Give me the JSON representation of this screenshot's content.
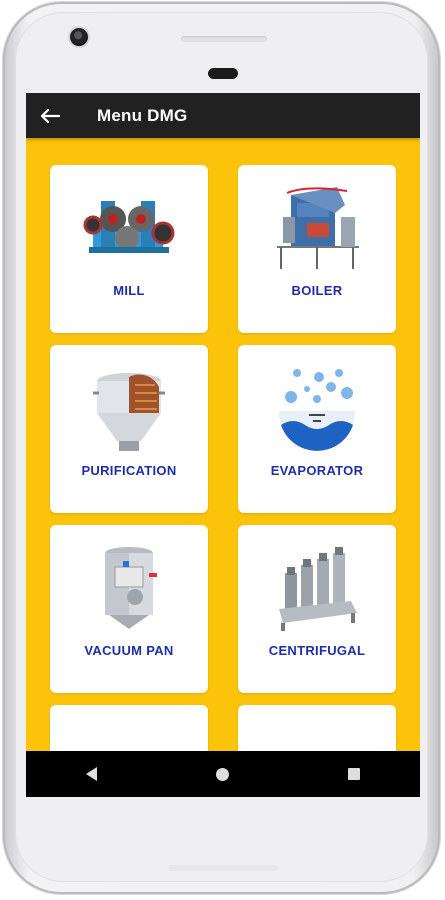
{
  "appbar": {
    "back_icon": "arrow-left-icon",
    "title": "Menu DMG"
  },
  "menu": {
    "items": [
      {
        "label": "MILL",
        "icon": "mill-machine-icon"
      },
      {
        "label": "BOILER",
        "icon": "boiler-icon"
      },
      {
        "label": "PURIFICATION",
        "icon": "purification-tank-icon"
      },
      {
        "label": "EVAPORATOR",
        "icon": "evaporator-flask-icon"
      },
      {
        "label": "VACUUM PAN",
        "icon": "vacuum-pan-icon"
      },
      {
        "label": "CENTRIFUGAL",
        "icon": "centrifugal-icon"
      },
      {
        "label": "",
        "icon": "partial-item-icon"
      },
      {
        "label": "",
        "icon": "partial-item-icon"
      }
    ]
  },
  "navbar": {
    "back": "nav-back-icon",
    "home": "nav-home-icon",
    "recents": "nav-recents-icon"
  },
  "colors": {
    "background": "#fcc30b",
    "appbar": "#212121",
    "label": "#1f2ea8"
  }
}
